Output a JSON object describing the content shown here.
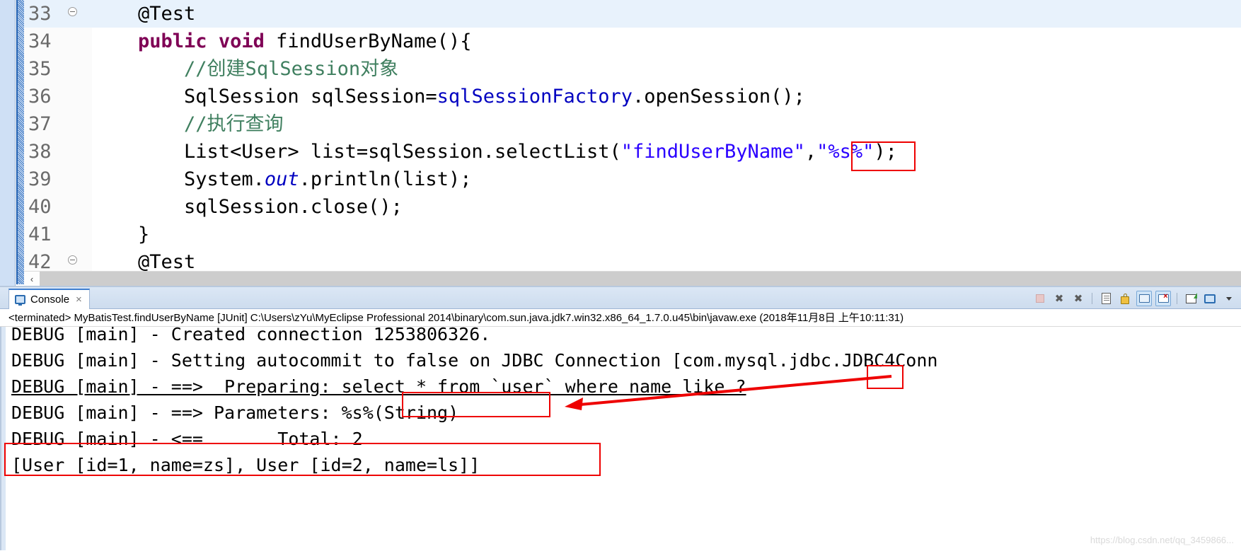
{
  "editor": {
    "name": "java-source-editor",
    "lines": [
      {
        "num": "33",
        "folding": true,
        "highlighted": true,
        "tokens": [
          {
            "t": "    ",
            "c": "plain"
          },
          {
            "t": "@Test",
            "c": "plain"
          }
        ]
      },
      {
        "num": "34",
        "folding": false,
        "highlighted": false,
        "tokens": [
          {
            "t": "    ",
            "c": "plain"
          },
          {
            "t": "public void ",
            "c": "kw"
          },
          {
            "t": "findUserByName(){",
            "c": "plain"
          }
        ]
      },
      {
        "num": "35",
        "folding": false,
        "highlighted": false,
        "tokens": [
          {
            "t": "        ",
            "c": "plain"
          },
          {
            "t": "//创建SqlSession对象",
            "c": "cmt"
          }
        ]
      },
      {
        "num": "36",
        "folding": false,
        "highlighted": false,
        "tokens": [
          {
            "t": "        SqlSession sqlSession=",
            "c": "plain"
          },
          {
            "t": "sqlSessionFactory",
            "c": "fld"
          },
          {
            "t": ".openSession();",
            "c": "plain"
          }
        ]
      },
      {
        "num": "37",
        "folding": false,
        "highlighted": false,
        "tokens": [
          {
            "t": "        ",
            "c": "plain"
          },
          {
            "t": "//执行查询",
            "c": "cmt"
          }
        ]
      },
      {
        "num": "38",
        "folding": false,
        "highlighted": false,
        "tokens": [
          {
            "t": "        List<User> list=sqlSession.selectList(",
            "c": "plain"
          },
          {
            "t": "\"findUserByName\"",
            "c": "str"
          },
          {
            "t": ",",
            "c": "plain"
          },
          {
            "t": "\"%s%\"",
            "c": "str"
          },
          {
            "t": ");",
            "c": "plain"
          }
        ]
      },
      {
        "num": "39",
        "folding": false,
        "highlighted": false,
        "tokens": [
          {
            "t": "        System.",
            "c": "plain"
          },
          {
            "t": "out",
            "c": "ital"
          },
          {
            "t": ".println(list);",
            "c": "plain"
          }
        ]
      },
      {
        "num": "40",
        "folding": false,
        "highlighted": false,
        "tokens": [
          {
            "t": "        sqlSession.close();",
            "c": "plain"
          }
        ]
      },
      {
        "num": "41",
        "folding": false,
        "highlighted": false,
        "tokens": [
          {
            "t": "    }",
            "c": "plain"
          }
        ]
      },
      {
        "num": "42",
        "folding": true,
        "highlighted": false,
        "tokens": [
          {
            "t": "    ",
            "c": "plain"
          },
          {
            "t": "@Test",
            "c": "plain"
          }
        ]
      }
    ],
    "hscroll": {
      "left_arrow": "‹"
    }
  },
  "console": {
    "tab": {
      "label": "Console",
      "close_label": "×"
    },
    "toolbar": {
      "icons": [
        {
          "name": "terminate-icon",
          "title": "Terminate"
        },
        {
          "name": "remove-launch-icon",
          "title": "Remove Launch"
        },
        {
          "name": "remove-all-terminated-icon",
          "title": "Remove All Terminated Launches"
        },
        {
          "name": "clear-console-icon",
          "title": "Clear Console"
        },
        {
          "name": "scroll-lock-icon",
          "title": "Scroll Lock"
        },
        {
          "name": "pin-console-icon",
          "title": "Pin Console"
        },
        {
          "name": "display-selected-console-icon",
          "title": "Display Selected Console"
        },
        {
          "name": "open-console-icon",
          "title": "Open Console"
        },
        {
          "name": "new-console-view-icon",
          "title": "New Console View"
        },
        {
          "name": "console-menu-caret-icon",
          "title": "View Menu"
        }
      ]
    },
    "status_line": "<terminated> MyBatisTest.findUserByName [JUnit] C:\\Users\\zYu\\MyEclipse Professional 2014\\binary\\com.sun.java.jdk7.win32.x86_64_1.7.0.u45\\bin\\javaw.exe (2018年11月8日 上午10:11:31)",
    "output_lines": [
      {
        "text": "DEBUG [main] - Created connection 1253806326.",
        "underline": false
      },
      {
        "text": "DEBUG [main] - Setting autocommit to false on JDBC Connection [com.mysql.jdbc.JDBC4Conn",
        "underline": false
      },
      {
        "text": "DEBUG [main] - ==>  Preparing: select * from `user` where name like ?",
        "underline": true
      },
      {
        "text": "DEBUG [main] - ==> Parameters: %s%(String)",
        "underline": false
      },
      {
        "text": "DEBUG [main] - <==       Total: 2",
        "underline": false
      },
      {
        "text": "[User [id=1, name=zs], User [id=2, name=ls]]",
        "underline": false
      }
    ]
  },
  "annotations": {
    "color": "#ee0000",
    "boxes": [
      {
        "name": "highlight-box-source-param",
        "label": "\"%s%\""
      },
      {
        "name": "highlight-box-sql-placeholder",
        "label": "?"
      },
      {
        "name": "highlight-box-parameters-value",
        "label": "%s%(String)"
      },
      {
        "name": "highlight-box-result-row",
        "label": "[User [id=1, name=zs], User [id=2, name=ls]]"
      }
    ],
    "arrow": {
      "name": "annotation-arrow",
      "from": "highlight-box-sql-placeholder",
      "to": "highlight-box-parameters-value"
    }
  },
  "watermark": {
    "text": "https://blog.csdn.net/qq_3459866..."
  }
}
